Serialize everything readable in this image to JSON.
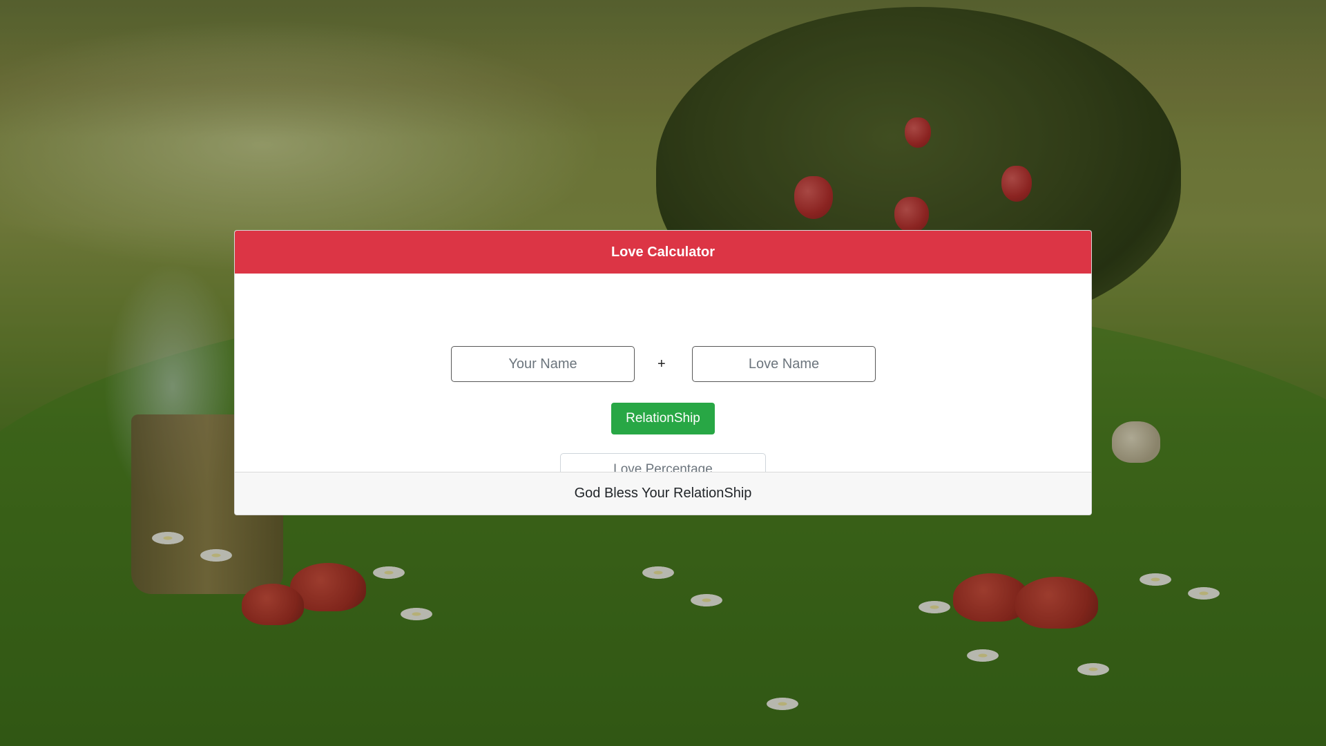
{
  "card": {
    "title": "Love Calculator",
    "your_name_placeholder": "Your Name",
    "plus_symbol": "+",
    "love_name_placeholder": "Love Name",
    "button_label": "RelationShip",
    "result_placeholder": "Love Percentage",
    "footer_text": "God Bless Your RelationShip"
  },
  "colors": {
    "header": "#dc3545",
    "button": "#28a745",
    "footer": "#f7f7f7"
  }
}
